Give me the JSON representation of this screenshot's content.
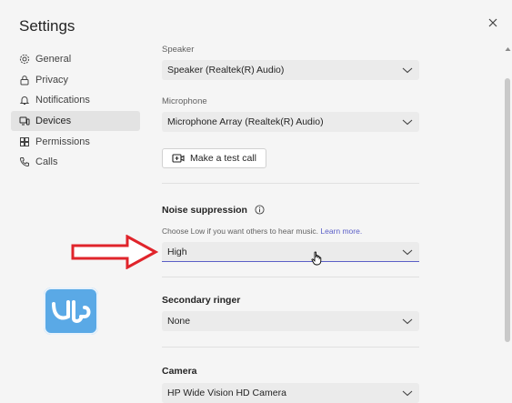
{
  "window": {
    "title": "Settings"
  },
  "icons": {
    "close": "close-icon",
    "general": "gear-icon",
    "privacy": "lock-icon",
    "notifications": "bell-icon",
    "devices": "devices-icon",
    "permissions": "grid-icon",
    "calls": "phone-icon",
    "test_call": "video-call-icon",
    "info": "info-icon",
    "chevron": "chevron-down-icon"
  },
  "sidebar": {
    "items": [
      {
        "label": "General"
      },
      {
        "label": "Privacy"
      },
      {
        "label": "Notifications"
      },
      {
        "label": "Devices"
      },
      {
        "label": "Permissions"
      },
      {
        "label": "Calls"
      }
    ],
    "active": "Devices"
  },
  "devices": {
    "speaker_label": "Speaker",
    "speaker_value": "Speaker (Realtek(R) Audio)",
    "microphone_label": "Microphone",
    "microphone_value": "Microphone Array (Realtek(R) Audio)",
    "test_call_label": "Make a test call",
    "noise_heading": "Noise suppression",
    "noise_hint": "Choose Low if you want others to hear music.",
    "noise_link": "Learn more.",
    "noise_value": "High",
    "ringer_heading": "Secondary ringer",
    "ringer_value": "None",
    "camera_heading": "Camera",
    "camera_value": "HP Wide Vision HD Camera"
  },
  "colors": {
    "accent": "#5b5fc7",
    "annotation_arrow": "#e0242b",
    "watermark": "#5aa9e6"
  }
}
